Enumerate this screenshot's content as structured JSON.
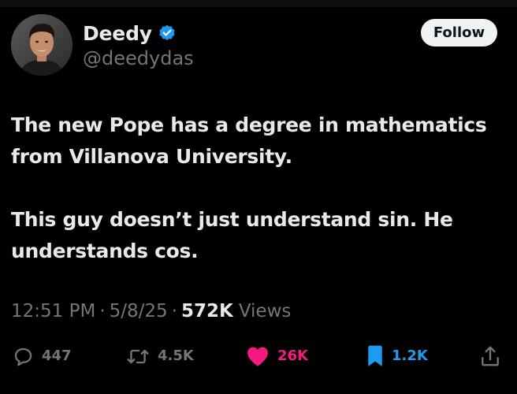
{
  "author": {
    "display_name": "Deedy",
    "handle": "@deedydas",
    "verified": true
  },
  "follow_button": {
    "label": "Follow"
  },
  "tweet": {
    "paragraphs": [
      "The new Pope has a degree in mathematics from Villanova University.",
      "This guy doesn’t just understand sin. He understands cos."
    ]
  },
  "meta": {
    "time": "12:51 PM",
    "separator": "·",
    "date": "5/8/25",
    "views_count": "572K",
    "views_label": "Views"
  },
  "actions": {
    "reply_count": "447",
    "repost_count": "4.5K",
    "like_count": "26K",
    "bookmark_count": "1.2K"
  },
  "colors": {
    "background": "#000000",
    "primary_text": "#e7e9ea",
    "secondary_text": "#71767b",
    "like": "#f91880",
    "bookmark": "#1d9bf0",
    "verified": "#1d9bf0"
  },
  "icons": {
    "reply": "speech-bubble-icon",
    "repost": "repost-arrows-icon",
    "like": "heart-icon",
    "bookmark": "bookmark-icon",
    "share": "share-icon",
    "verified": "verified-badge-icon"
  }
}
